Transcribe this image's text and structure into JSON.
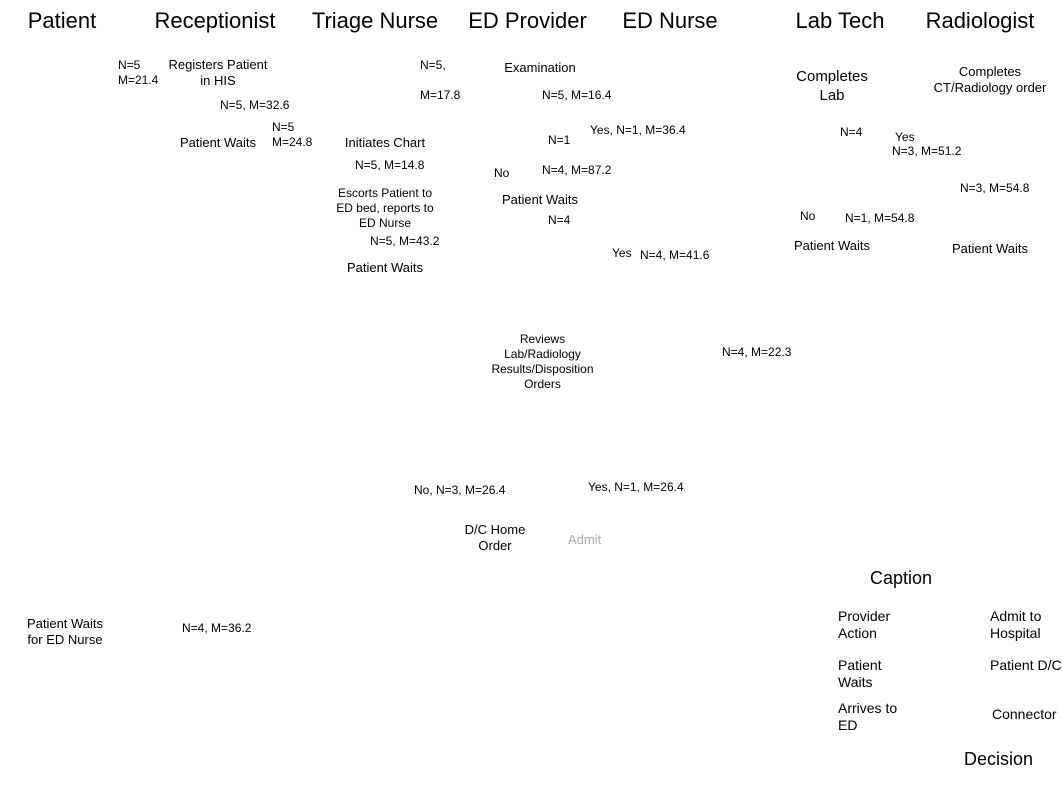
{
  "lanes": {
    "patient": "Patient",
    "receptionist": "Receptionist",
    "triage": "Triage Nurse",
    "provider": "ED Provider",
    "ednurse": "ED Nurse",
    "labtech": "Lab Tech",
    "radiologist": "Radiologist"
  },
  "nodes": {
    "registers": "Registers Patient in HIS",
    "pw1": "Patient Waits",
    "n5m214": "N=5\nM=21.4",
    "n5m326": "N=5, M=32.6",
    "n5m248": "N=5\nM=24.8",
    "initiates": "Initiates Chart",
    "n5m178": "N=5,\n\nM=17.8",
    "n5m148": "N=5, M=14.8",
    "escorts": "Escorts Patient to ED bed, reports to ED Nurse",
    "n5m432": "N=5, M=43.2",
    "pw2": "Patient Waits",
    "exam": "Examination",
    "n5m164": "N=5, M=16.4",
    "n1": "N=1",
    "no1": "No",
    "n4m872": "N=4, M=87.2",
    "pw3": "Patient Waits",
    "n4a": "N=4",
    "yes1": "Yes, N=1, M=36.4",
    "yes_b": "Yes",
    "n4m416": "N=4, M=41.6",
    "completes_lab": "Completes Lab",
    "n4b": "N=4",
    "yes_c": "Yes",
    "n3m512": "N=3, M=51.2",
    "no2": "No",
    "n1m548": "N=1, M=54.8",
    "pw4": "Patient Waits",
    "completes_rad": "Completes CT/Radiology order",
    "n3m548": "N=3, M=54.8",
    "pw5": "Patient Waits",
    "reviews": "Reviews Lab/Radiology Results/Disposition Orders",
    "n4m223": "N=4, M=22.3",
    "no3": "No, N=3, M=26.4",
    "yes3": "Yes, N=1, M=26.4",
    "dchome": "D/C Home Order",
    "admit": "Admit",
    "pw6": "Patient Waits for ED Nurse",
    "n4m362": "N=4, M=36.2"
  },
  "caption": {
    "title": "Caption",
    "provider": "Provider Action",
    "waits": "Patient Waits",
    "arrives": "Arrives to ED",
    "admit": "Admit to Hospital",
    "dch": "Patient D/C  Home",
    "conn": "Connector",
    "decision": "Decision"
  }
}
